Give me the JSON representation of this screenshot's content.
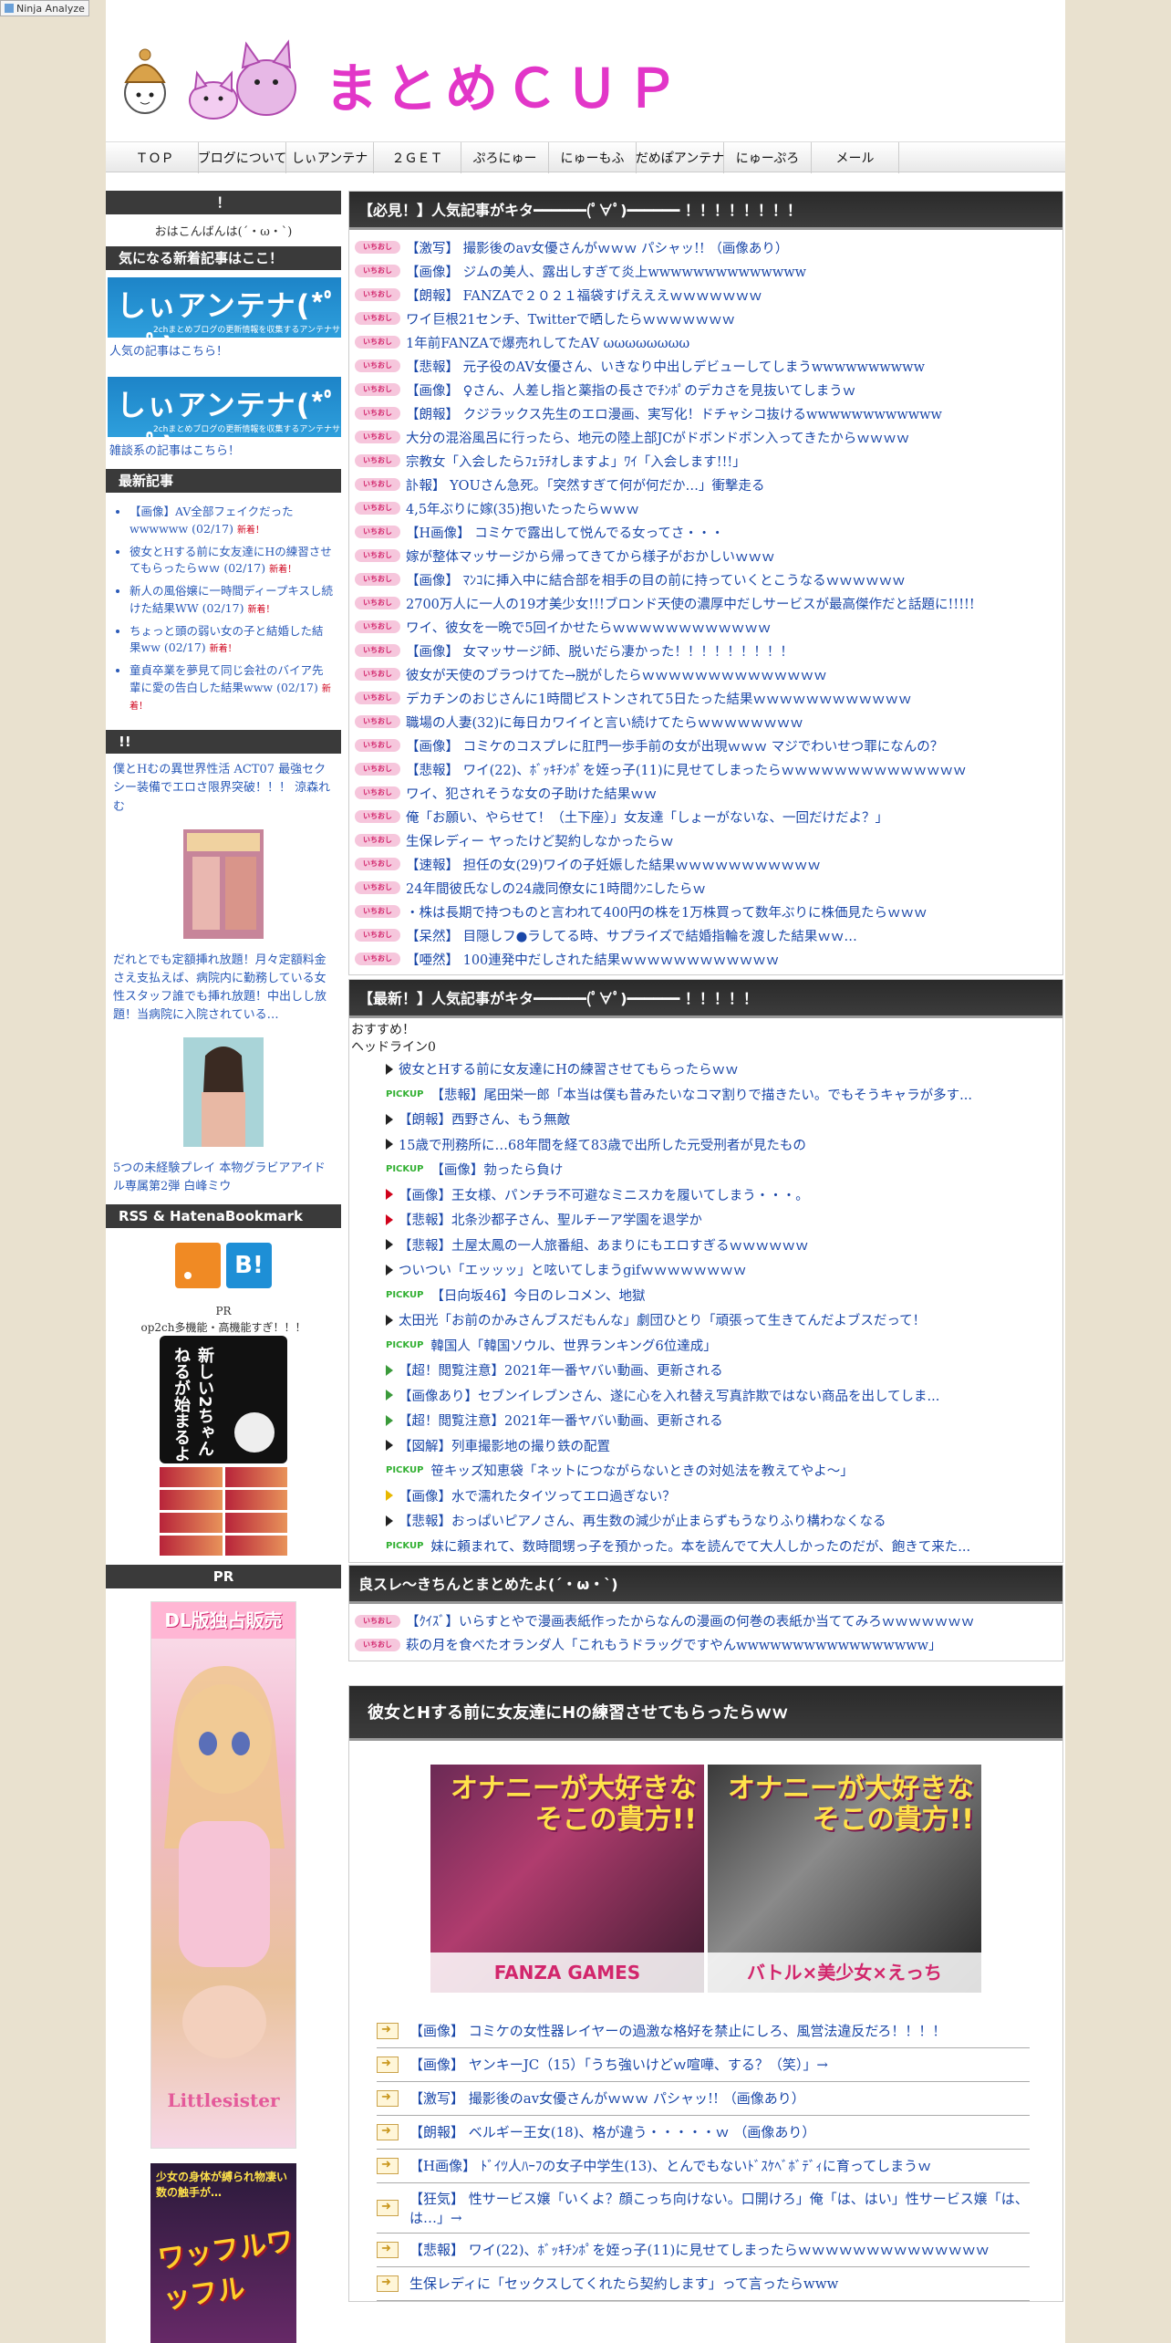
{
  "ninja_label": "Ninja Analyze",
  "header": {
    "site_title": "まとめＣＵＰ"
  },
  "nav": [
    {
      "label": "ＴＯＰ"
    },
    {
      "label": "ブログについて"
    },
    {
      "label": "しぃアンテナ"
    },
    {
      "label": "２ＧＥＴ"
    },
    {
      "label": "ぷろにゅー"
    },
    {
      "label": "にゅーもふ"
    },
    {
      "label": "だめぽアンテナ"
    },
    {
      "label": "にゅーぷろ"
    },
    {
      "label": "メール"
    }
  ],
  "sidebar": {
    "greet_header": "！",
    "greet_text": "おはこんばんは(´・ω・`)",
    "new_articles_header": "気になる新着記事はここ！",
    "antenna1": {
      "title": "しぃアンテナ(*ﾟーﾟ)",
      "sub": "2chまとめブログの更新情報を収集するアンテナサイト",
      "link": "人気の記事はこちら！"
    },
    "antenna2": {
      "title": "しぃアンテナ(*ﾟーﾟ)",
      "sub": "2chまとめブログの更新情報を収集するアンテナサイト",
      "link": "雑談系の記事はこちら！"
    },
    "recent_header": "最新記事",
    "new_mark": "新着！",
    "recent": [
      {
        "text": "【画像】AV全部フェイクだったwwwwww (02/17)"
      },
      {
        "text": "彼女とHする前に女友達にHの練習させてもらったらｗｗ (02/17)"
      },
      {
        "text": "新人の風俗嬢に一時間ディープキスし続けた結果WW (02/17)"
      },
      {
        "text": "ちょっと頭の弱い女の子と結婚した結果ww (02/17)"
      },
      {
        "text": "童貞卒業を夢見て同じ会社のバイア先輩に愛の告白した結果www (02/17)"
      }
    ],
    "pr_header": "!!",
    "pr1": "僕とHむの異世界性活 ACT07 最強セクシー装備でエロさ限界突破！！！ 涼森れむ",
    "pr2": "だれとでも定額挿れ放題！月々定額料金さえ支払えば、病院内に勤務している女性スタッフ誰でも挿れ放題！中出しし放題！当病院に入院されている…",
    "pr3": "5つの未経験プレイ 本物グラビアアイドル専属第2弾 白峰ミウ",
    "rss_header": "RSS & HatenaBookmark",
    "hatena_label": "B!",
    "pr_small_title": "PR",
    "pr_small_text": "op2ch多機能・高機能すぎ！！！",
    "cat_text": "新しい2ちゃんねるが始まるよ",
    "pr_header2": "PR",
    "banner_dl_top": "DL版独占販売",
    "banner_dl_name": "Littlesister",
    "banner_wf_top": "少女の身体が縛られ物凄い数の触手が…",
    "banner_wf_title": "ワッフルワッフル"
  },
  "main": {
    "popular_header": "【必見！】人気記事がキタ━━━━━━(ﾟ∀ﾟ)━━━━━━ ！！！！！！！！",
    "badge": "いちおし",
    "popular": [
      "【激写】 撮影後のav女優さんがｗｗｗ パシャッ!! （画像あり）",
      "【画像】 ジムの美人、露出しすぎて炎上wwwwwwwwwwwwww",
      "【朗報】 FANZAで２０２１福袋すげえええｗｗｗｗｗｗｗ",
      "ワイ巨根21センチ、Twitterで晒したらｗｗｗｗｗｗｗ",
      "1年前FANZAで爆売れしてたAV ωωωωωωωω",
      "【悲報】 元子役のAV女優さん、いきなり中出しデビューしてしまうwwwwwwwwww",
      "【画像】 ♀さん、人差し指と薬指の長さでﾁﾝﾎﾟのデカさを見抜いてしまうｗ",
      "【朗報】 クジラックス先生のエロ漫画、実写化！ドチャシコ抜けるwwwwwwwwwwww",
      "大分の混浴風呂に行ったら、地元の陸上部JCがドボンドボン入ってきたからｗｗｗｗ",
      "宗教女「入会したらﾌｪﾗﾁｵしますよ」ﾜｲ「入会します!!!」",
      "訃報】 YOUさん急死。「突然すぎて何が何だか…」衝撃走る",
      "4,5年ぶりに嫁(35)抱いたったらｗｗｗ",
      "【H画像】 コミケで露出して悦んでる女ってさ・・・",
      "嫁が整体マッサージから帰ってきてから様子がおかしいｗｗｗ",
      "【画像】 ﾏﾝｺに挿入中に結合部を相手の目の前に持っていくとこうなるｗｗｗｗｗｗ",
      "2700万人に一人の19才美少女!!!ブロンド天使の濃厚中だしサービスが最高傑作だと話題に!!!!!",
      "ワイ、彼女を一晩で5回イかせたらｗｗｗｗｗｗｗｗｗｗｗｗ",
      "【画像】 女マッサージ師、脱いだら凄かった！！！！！！！！！",
      "彼女が天使のブラつけてた→脱がしたらｗｗｗｗｗｗｗｗｗｗｗｗｗｗ",
      "デカチンのおじさんに1時間ピストンされて5日たった結果ｗｗｗｗｗｗｗｗｗｗｗｗ",
      "職場の人妻(32)に毎日カワイイと言い続けてたらｗｗｗｗｗｗｗｗ",
      "【画像】 コミケのコスプレに肛門一歩手前の女が出現ｗｗｗ マジでわいせつ罪になんの？",
      "【悲報】 ワイ(22)、ﾎﾞｯｷﾁﾝﾎﾟを姪っ子(11)に見せてしまったらｗｗｗｗｗｗｗｗｗｗｗｗｗｗ",
      "ワイ、犯されそうな女の子助けた結果ｗｗ",
      "俺「お願い、やらせて！（土下座）」女友達「しょーがないな、一回だけだよ？」",
      "生保レディー ヤったけど契約しなかったらｗ",
      "【速報】 担任の女(29)ワイの子妊娠した結果ｗｗｗｗｗｗｗｗｗｗｗ",
      "24年間彼氏なしの24歳同僚女に1時間ｸﾝﾆしたらｗ",
      "・株は長期で持つものと言われて400円の株を1万株買って数年ぶりに株価見たらｗｗｗ",
      "【呆然】 目隠しフ●ラしてる時、サプライズで結婚指輪を渡した結果ｗｗ…",
      "【唖然】 100連発中だしされた結果ｗｗｗｗｗｗｗｗｗｗｗｗ"
    ],
    "latest_header": "【最新！】人気記事がキタ━━━━━━(ﾟ∀ﾟ)━━━━━━ ！！！！！",
    "latest_recommend": "おすすめ！",
    "latest_headline": "ヘッドライン0",
    "pickup_label": "PICKUP",
    "latest": [
      {
        "type": "tri",
        "color": "#222",
        "text": "彼女とHする前に女友達にHの練習させてもらったらｗｗ"
      },
      {
        "type": "pickup",
        "text": "【悲報】尾田栄一郎「本当は僕も昔みたいなコマ割りで描きたい。でもそうキャラが多す..."
      },
      {
        "type": "tri",
        "color": "#222",
        "text": "【朗報】西野さん、もう無敵"
      },
      {
        "type": "tri",
        "color": "#222",
        "text": "15歳で刑務所に…68年間を経て83歳で出所した元受刑者が見たもの"
      },
      {
        "type": "pickup",
        "text": "【画像】勃ったら負け"
      },
      {
        "type": "tri",
        "color": "#d0021b",
        "text": "【画像】王女様、パンチラ不可避なミニスカを履いてしまう・・・。"
      },
      {
        "type": "tri",
        "color": "#d0021b",
        "text": "【悲報】北条沙都子さん、聖ルチーア学園を退学か"
      },
      {
        "type": "tri",
        "color": "#222",
        "text": "【悲報】土屋太鳳の一人旅番組、あまりにもエロすぎるｗｗｗｗｗｗ"
      },
      {
        "type": "tri",
        "color": "#222",
        "text": "ついつい「エッッッ」と呟いてしまうgifｗｗｗｗｗｗｗｗ"
      },
      {
        "type": "pickup",
        "text": "【日向坂46】今日のレコメン、地獄"
      },
      {
        "type": "tri",
        "color": "#222",
        "text": "太田光「お前のかみさんブスだもんな」劇団ひとり「頑張って生きてんだよブスだって！"
      },
      {
        "type": "pickup",
        "text": "韓国人「韓国ソウル、世界ランキング6位達成」"
      },
      {
        "type": "tri",
        "color": "#3a9a3a",
        "text": "【超！閲覧注意】2021年一番ヤバい動画、更新される"
      },
      {
        "type": "tri",
        "color": "#3a9a3a",
        "text": "【画像あり】セブンイレブンさん、遂に心を入れ替え写真詐欺ではない商品を出してしま..."
      },
      {
        "type": "tri",
        "color": "#3a9a3a",
        "text": "【超！閲覧注意】2021年一番ヤバい動画、更新される"
      },
      {
        "type": "tri",
        "color": "#222",
        "text": "【図解】列車撮影地の撮り鉄の配置"
      },
      {
        "type": "pickup",
        "text": "笹キッズ知恵袋「ネットにつながらないときの対処法を教えてやよ～」"
      },
      {
        "type": "tri",
        "color": "#e8b800",
        "text": "【画像】水で濡れたタイツってエロ過ぎない？"
      },
      {
        "type": "tri",
        "color": "#222",
        "text": "【悲報】おっぱいピアノさん、再生数の減少が止まらずもうなりふり構わなくなる"
      },
      {
        "type": "pickup",
        "text": "妹に頼まれて、数時間甥っ子を預かった。本を読んでて大人しかったのだが、飽きて来た..."
      }
    ],
    "good_header": "良スレ～きちんとまとめたよ(´・ω・`)",
    "good": [
      "【ｸｲｽﾞ】いらすとやで漫画表紙作ったからなんの漫画の何巻の表紙か当ててみろｗｗｗｗｗｗｗ",
      "萩の月を食べたオランダ人「これもうドラッグですやんwwwwwwwwwwwwwwwww」"
    ],
    "article_title": "彼女とHする前に女友達にHの練習させてもらったらｗｗ",
    "ad1_title": "オナニーが大好きなそこの貴方!!",
    "ad1_bottom": "FANZA GAMES",
    "ad2_title": "オナニーが大好きなそこの貴方!!",
    "ad2_bottom": "バトル×美少女×えっち",
    "article_links": [
      "【画像】 コミケの女性器レイヤーの過激な格好を禁止にしろ、風営法違反だろ！！！！",
      "【画像】 ヤンキーJC（15）「うち強いけどｗ喧嘩、する？（笑）」→",
      "【激写】 撮影後のav女優さんがｗｗｗ パシャッ!! （画像あり）",
      "【朗報】 ベルギー王女(18)、格が違う・・・・・ｗ （画像あり）",
      "【H画像】 ﾄﾞｲﾂ人ﾊｰﾌの女子中学生(13)、とんでもないﾄﾞｽｹﾍﾞﾎﾞﾃﾞｨに育ってしまうｗ",
      "【狂気】 性サービス嬢「いくよ？顔こっち向けない。口開けろ」俺「は、はい」性サービス嬢「は、は…」→",
      "【悲報】 ワイ(22)、ﾎﾞｯｷﾁﾝﾎﾟを姪っ子(11)に見せてしまったらｗｗｗｗｗｗｗｗｗｗｗｗｗｗ",
      "生保レディに「セックスしてくれたら契約します」って言ったらwww"
    ]
  }
}
